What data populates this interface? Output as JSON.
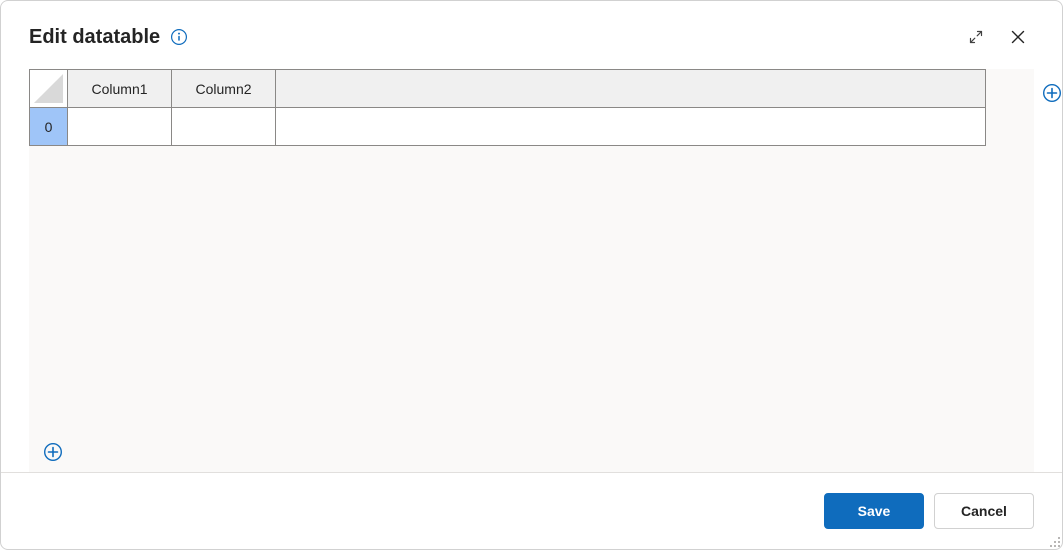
{
  "dialog": {
    "title": "Edit datatable"
  },
  "table": {
    "columns": [
      "Column1",
      "Column2"
    ],
    "rows": [
      {
        "index": "0",
        "cells": [
          "",
          ""
        ]
      }
    ]
  },
  "footer": {
    "save_label": "Save",
    "cancel_label": "Cancel"
  },
  "colors": {
    "accent": "#0f6cbd",
    "row_header_selected": "#9fc5f8",
    "header_bg": "#f0f0f0",
    "grid_bg": "#faf9f8"
  }
}
